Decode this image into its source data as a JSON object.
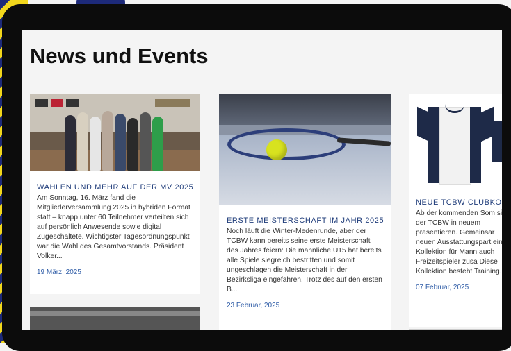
{
  "page": {
    "title": "News und Events"
  },
  "cards": [
    {
      "title": "WAHLEN UND MEHR AUF DER MV 2025",
      "excerpt": "Am Sonntag, 16. März fand die Mitgliederversammlung 2025 in hybriden Format statt – knapp unter 60 Teilnehmer verteilten sich auf persönlich Anwesende sowie digital Zugeschaltete. Wichtigster Tagesordnungspunkt war die Wahl des Gesamtvorstands. Präsident Volker...",
      "date": "19 März, 2025"
    },
    {
      "title": "ERSTE MEISTERSCHAFT IM JAHR 2025",
      "excerpt": "Noch läuft die Winter-Medenrunde, aber der TCBW kann bereits seine erste Meisterschaft des Jahres feiern: Die männliche U15 hat bereits alle Spiele siegreich bestritten und somit ungeschlagen die Meisterschaft in der Bezirksliga eingefahren. Trotz des auf den ersten B...",
      "date": "23 Februar, 2025"
    },
    {
      "title": "NEUE TCBW CLUBKOL",
      "excerpt": "Ab der kommenden Som sich der TCBW in neuem präsentieren. Gemeinsar neuen Ausstattungspart eine Kollektion für Mann auch Freizeitspieler zusa Diese Kollektion besteht Training...",
      "date": "07 Februar, 2025"
    }
  ],
  "colors": {
    "accent": "#1f3c7a",
    "date": "#2d5ba6",
    "frame": "#0c0c0c",
    "brand_yellow": "#f2d71c",
    "brand_blue": "#1d2a7a"
  }
}
